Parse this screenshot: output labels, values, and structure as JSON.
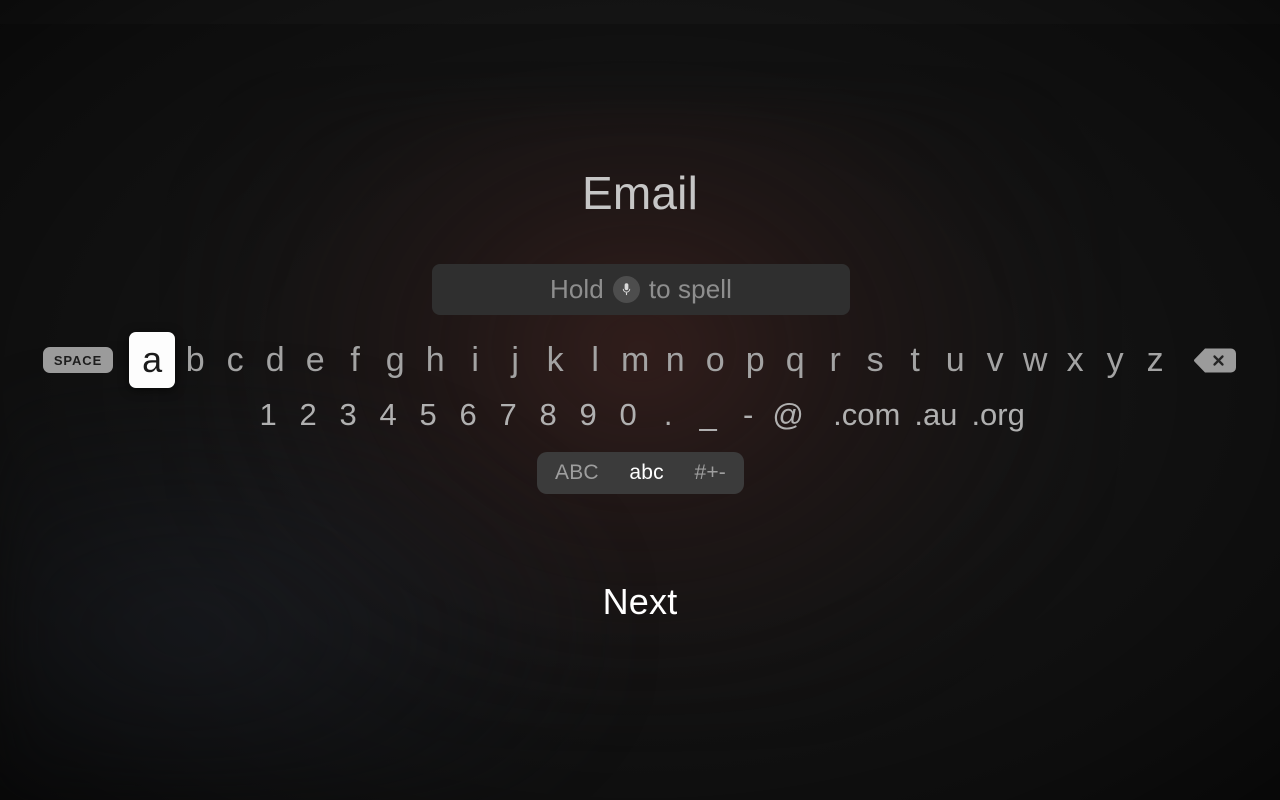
{
  "screen": {
    "title": "Email",
    "background_color": "#141414",
    "accent_glow_color": "#4a2622"
  },
  "text_field": {
    "value": "",
    "placeholder_before": "Hold",
    "placeholder_after": "to spell",
    "mic_icon": "microphone-icon",
    "background_color": "#2f2f2f"
  },
  "keyboard": {
    "space_key": {
      "label": "SPACE",
      "background_color": "#9b9b9b"
    },
    "letters": [
      {
        "label": "a",
        "selected": true
      },
      {
        "label": "b",
        "selected": false
      },
      {
        "label": "c",
        "selected": false
      },
      {
        "label": "d",
        "selected": false
      },
      {
        "label": "e",
        "selected": false
      },
      {
        "label": "f",
        "selected": false
      },
      {
        "label": "g",
        "selected": false
      },
      {
        "label": "h",
        "selected": false
      },
      {
        "label": "i",
        "selected": false
      },
      {
        "label": "j",
        "selected": false
      },
      {
        "label": "k",
        "selected": false
      },
      {
        "label": "l",
        "selected": false
      },
      {
        "label": "m",
        "selected": false
      },
      {
        "label": "n",
        "selected": false
      },
      {
        "label": "o",
        "selected": false
      },
      {
        "label": "p",
        "selected": false
      },
      {
        "label": "q",
        "selected": false
      },
      {
        "label": "r",
        "selected": false
      },
      {
        "label": "s",
        "selected": false
      },
      {
        "label": "t",
        "selected": false
      },
      {
        "label": "u",
        "selected": false
      },
      {
        "label": "v",
        "selected": false
      },
      {
        "label": "w",
        "selected": false
      },
      {
        "label": "x",
        "selected": false
      },
      {
        "label": "y",
        "selected": false
      },
      {
        "label": "z",
        "selected": false
      }
    ],
    "delete_key": {
      "icon": "backspace-icon"
    },
    "numbers": [
      "1",
      "2",
      "3",
      "4",
      "5",
      "6",
      "7",
      "8",
      "9",
      "0"
    ],
    "symbols": [
      ".",
      "_",
      "-",
      "@"
    ],
    "domains": [
      ".com",
      ".au",
      ".org"
    ]
  },
  "mode_selector": {
    "options": [
      {
        "label": "ABC",
        "active": false
      },
      {
        "label": "abc",
        "active": true
      },
      {
        "label": "#+-",
        "active": false
      }
    ]
  },
  "actions": {
    "next_label": "Next"
  }
}
